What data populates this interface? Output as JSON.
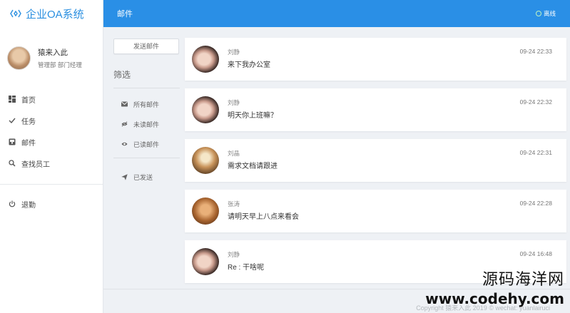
{
  "app": {
    "title": "企业OA系统"
  },
  "user": {
    "name": "猿来入此",
    "role": "管理部 部门经理"
  },
  "sidebar": {
    "items": [
      {
        "label": "首页",
        "icon": "dashboard-icon"
      },
      {
        "label": "任务",
        "icon": "check-icon"
      },
      {
        "label": "邮件",
        "icon": "inbox-icon"
      },
      {
        "label": "查找员工",
        "icon": "search-icon"
      }
    ],
    "logout": {
      "label": "退勤",
      "icon": "power-icon"
    }
  },
  "header": {
    "title": "邮件",
    "status": "离线"
  },
  "mail_nav": {
    "compose": "发送邮件",
    "filter_title": "筛选",
    "filters": [
      {
        "label": "所有邮件",
        "icon": "envelope-icon"
      },
      {
        "label": "未读邮件",
        "icon": "eye-slash-icon"
      },
      {
        "label": "已读邮件",
        "icon": "eye-icon"
      }
    ],
    "sent": {
      "label": "已发送",
      "icon": "paper-plane-icon"
    }
  },
  "mails": [
    {
      "sender": "刘静",
      "subject": "来下我办公室",
      "time": "09-24 22:33"
    },
    {
      "sender": "刘静",
      "subject": "明天你上班嘛？",
      "time": "09-24 22:32"
    },
    {
      "sender": "刘晶",
      "subject": "需求文档请跟进",
      "time": "09-24 22:31"
    },
    {
      "sender": "张涛",
      "subject": "请明天早上八点来看会",
      "time": "09-24 22:28"
    },
    {
      "sender": "刘静",
      "subject": "Re : 干啥呢",
      "time": "09-24 16:48"
    }
  ],
  "footer": {
    "text": "Copyright 猿来入此 2019 ©  wechat: yuanlairuci"
  },
  "watermark": {
    "text": "源码海洋网",
    "url": "www.codehy.com"
  },
  "colors": {
    "accent": "#2a8fe6",
    "status_online": "#bff3c0"
  }
}
